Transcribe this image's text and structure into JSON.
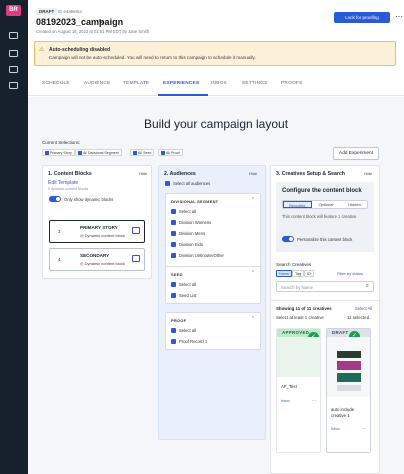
{
  "sidebar": {
    "logo_text": "BR",
    "icons": [
      "dashboard-icon",
      "megaphone-icon",
      "image-icon",
      "people-icon",
      "chart-icon"
    ]
  },
  "header": {
    "status_badge": "DRAFT",
    "campaign_id": "ID e4a8e8cc",
    "title": "08192023_campaign",
    "meta": "Created on August 18, 2023 at 01:51 PM EDT by Jane Smith",
    "lock_button": "Lock for proofing",
    "more": "⋯"
  },
  "alert": {
    "title": "Auto-scheduling disabled",
    "body": "Campaign will not be auto-scheduled. You will need to return to this campaign to schedule it manually."
  },
  "tabs": [
    {
      "label": "SCHEDULE",
      "active": false
    },
    {
      "label": "AUDIENCE",
      "active": false
    },
    {
      "label": "TEMPLATE",
      "active": false
    },
    {
      "label": "EXPERIENCES",
      "active": true
    },
    {
      "label": "INBOX",
      "active": false
    },
    {
      "label": "SETTINGS",
      "active": false
    },
    {
      "label": "PROOFS",
      "active": false
    }
  ],
  "canvas": {
    "heading": "Build your campaign layout",
    "current_selections_label": "Current Selections:",
    "chips": [
      "Primary Story",
      "All Divisional Segment",
      "All Seed",
      "All Proof"
    ],
    "add_experiment": "Add Experiment"
  },
  "content_blocks": {
    "title": "1. Content Blocks",
    "hide": "Hide",
    "edit_template": "Edit Template",
    "subtitle": "5 dynamic content blocks",
    "toggle_label": "Only show dynamic blocks",
    "blocks": [
      {
        "num": "3",
        "name": "PRIMARY STORY",
        "detail": "◎ Dynamic content block"
      },
      {
        "num": "4",
        "name": "SECONDARY",
        "detail": "◎ Dynamic content block"
      }
    ]
  },
  "audiences": {
    "title": "2. Audiences",
    "hide": "Hide",
    "select_all_audiences": "Select all audiences",
    "groups": [
      {
        "name": "DIVISIONAL SEGMENT",
        "items": [
          "Select all",
          "Division Womens",
          "Division Mens",
          "Division Kids",
          "Division Unknown/Other"
        ]
      },
      {
        "name": "SEED",
        "items": [
          "Select all",
          "Seed List"
        ]
      },
      {
        "name": "PROOF",
        "items": [
          "Select all",
          "Proof Record 1"
        ]
      }
    ]
  },
  "creatives": {
    "title": "3. Creatives Setup & Search",
    "hide": "Hide",
    "config_title": "Configure the content block",
    "segments": [
      "Required",
      "Optional",
      "Hidden"
    ],
    "active_segment": "Required",
    "note": "This content block will feature 1 creative.",
    "personalize_label": "Personalize this content block",
    "search_heading": "Search Creatives",
    "filter_chips": [
      "Name",
      "Tag",
      "ID"
    ],
    "active_filter": "Name",
    "filter_status": "Filter by status",
    "search_placeholder": "Search by Name",
    "showing": "Showing 11 of 11 creatives",
    "select_all": "Select All",
    "select_atleast": "Select at least 1 creative",
    "selected_count": "11 selected",
    "cards": [
      {
        "status": "APPROVED",
        "name": "AF_Test",
        "location": "Inbox",
        "checked": true
      },
      {
        "status": "DRAFT",
        "name": "auto include creative 1",
        "location": "Inbox",
        "checked": true
      }
    ]
  },
  "colors": {
    "accent": "#2a5bd7",
    "sidebar": "#17212e",
    "approved": "#1aa04b",
    "warning_bg": "#fbf1d9"
  }
}
